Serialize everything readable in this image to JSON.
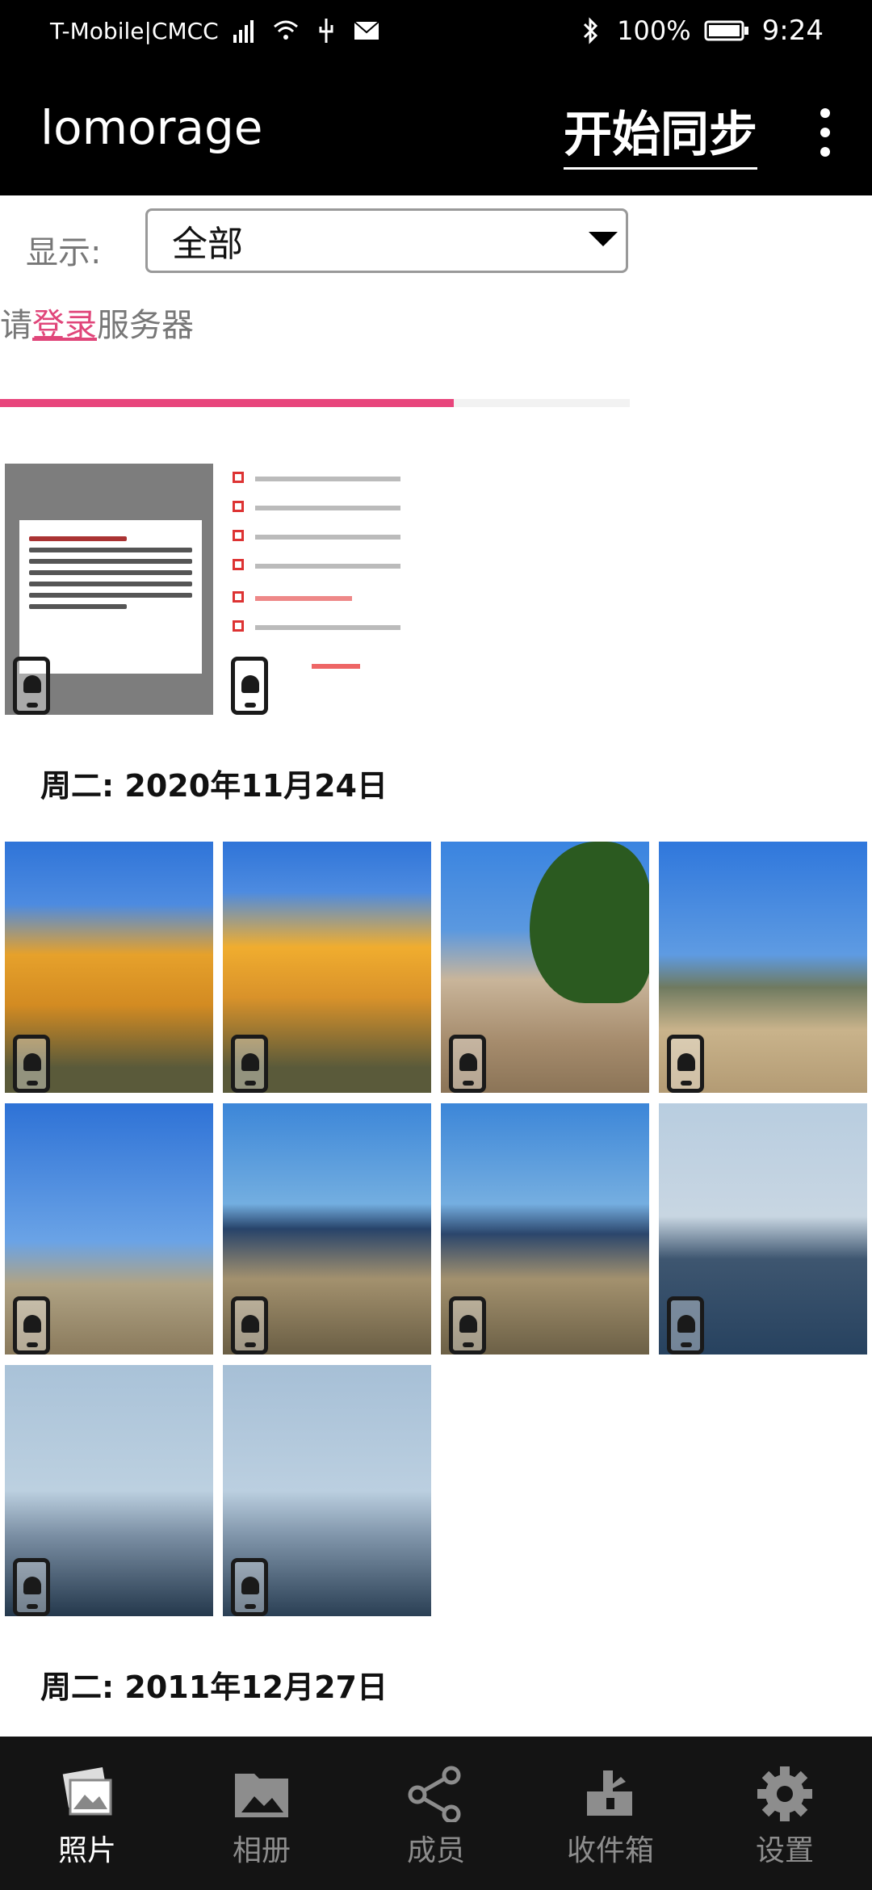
{
  "status_bar": {
    "carrier": "T-Mobile|CMCC",
    "battery": "100%",
    "time": "9:24"
  },
  "app_bar": {
    "title": "lomorage",
    "sync_button": "开始同步"
  },
  "filter": {
    "label": "显示:",
    "selected": "全部"
  },
  "login_prompt": {
    "before": "请",
    "link": "登录",
    "after": "服务器"
  },
  "progress": {
    "value": 0.72
  },
  "sections": [
    {
      "date": "周二: 2020年11月24日"
    },
    {
      "date": "周二: 2011年12月27日"
    }
  ],
  "bottom_nav": [
    {
      "label": "照片",
      "icon": "photos-icon",
      "active": true
    },
    {
      "label": "相册",
      "icon": "album-icon",
      "active": false
    },
    {
      "label": "成员",
      "icon": "share-icon",
      "active": false
    },
    {
      "label": "收件箱",
      "icon": "inbox-icon",
      "active": false
    },
    {
      "label": "设置",
      "icon": "gear-icon",
      "active": false
    }
  ]
}
